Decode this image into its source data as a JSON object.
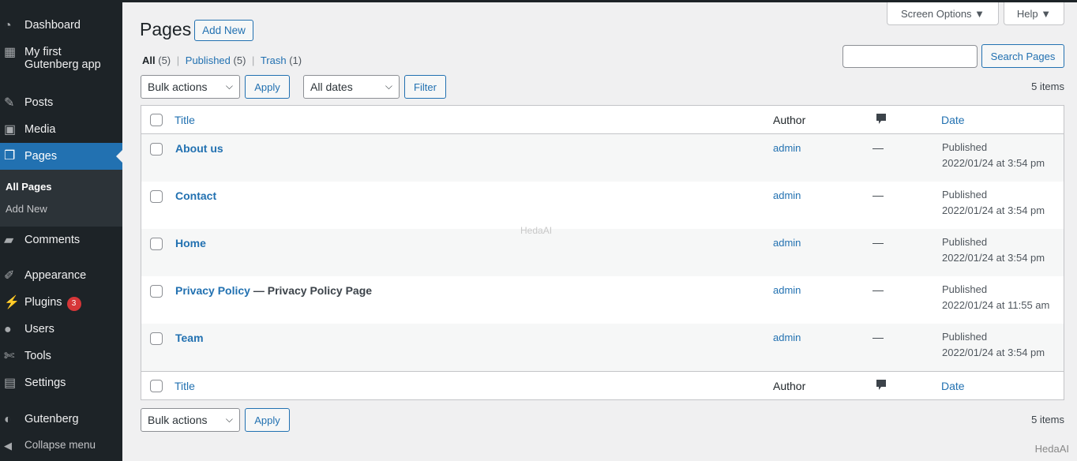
{
  "sidebar": {
    "items": [
      {
        "label": "Dashboard",
        "icon": "dashboard-icon"
      },
      {
        "label": "My first",
        "label2": "Gutenberg app",
        "icon": "grid-icon"
      },
      {
        "label": "Posts",
        "icon": "pin-icon"
      },
      {
        "label": "Media",
        "icon": "media-icon"
      },
      {
        "label": "Pages",
        "icon": "pages-icon"
      },
      {
        "label": "Comments",
        "icon": "comment-icon"
      },
      {
        "label": "Appearance",
        "icon": "brush-icon"
      },
      {
        "label": "Plugins",
        "icon": "plugin-icon",
        "badge": "3"
      },
      {
        "label": "Users",
        "icon": "user-icon"
      },
      {
        "label": "Tools",
        "icon": "wrench-icon"
      },
      {
        "label": "Settings",
        "icon": "settings-icon"
      },
      {
        "label": "Gutenberg",
        "icon": "gutenberg-icon"
      },
      {
        "label": "Collapse menu",
        "icon": "collapse-icon"
      }
    ],
    "submenu": [
      "All Pages",
      "Add New"
    ]
  },
  "header": {
    "screen_options": "Screen Options ▼",
    "help": "Help ▼",
    "title": "Pages",
    "add_new": "Add New"
  },
  "filters": {
    "all": "All",
    "all_count": "(5)",
    "published": "Published",
    "published_count": "(5)",
    "trash": "Trash",
    "trash_count": "(1)",
    "sep": "|"
  },
  "search": {
    "value": "",
    "button": "Search Pages"
  },
  "toolbar": {
    "bulk": "Bulk actions",
    "apply": "Apply",
    "dates": "All dates",
    "filter": "Filter",
    "count": "5 items"
  },
  "table": {
    "columns": {
      "title": "Title",
      "author": "Author",
      "comments_icon": "comment-bubble-icon",
      "date": "Date"
    },
    "rows": [
      {
        "title": "About us",
        "suffix": "",
        "author": "admin",
        "comments": "—",
        "status": "Published",
        "date": "2022/01/24 at 3:54 pm"
      },
      {
        "title": "Contact",
        "suffix": "",
        "author": "admin",
        "comments": "—",
        "status": "Published",
        "date": "2022/01/24 at 3:54 pm"
      },
      {
        "title": "Home",
        "suffix": "",
        "author": "admin",
        "comments": "—",
        "status": "Published",
        "date": "2022/01/24 at 3:54 pm"
      },
      {
        "title": "Privacy Policy",
        "suffix": " — Privacy Policy Page",
        "author": "admin",
        "comments": "—",
        "status": "Published",
        "date": "2022/01/24 at 11:55 am"
      },
      {
        "title": "Team",
        "suffix": "",
        "author": "admin",
        "comments": "—",
        "status": "Published",
        "date": "2022/01/24 at 3:54 pm"
      }
    ]
  },
  "watermark": "HedaAI",
  "colors": {
    "sidebar": "#1d2327",
    "accent": "#2271b1",
    "badge": "#d63638"
  }
}
